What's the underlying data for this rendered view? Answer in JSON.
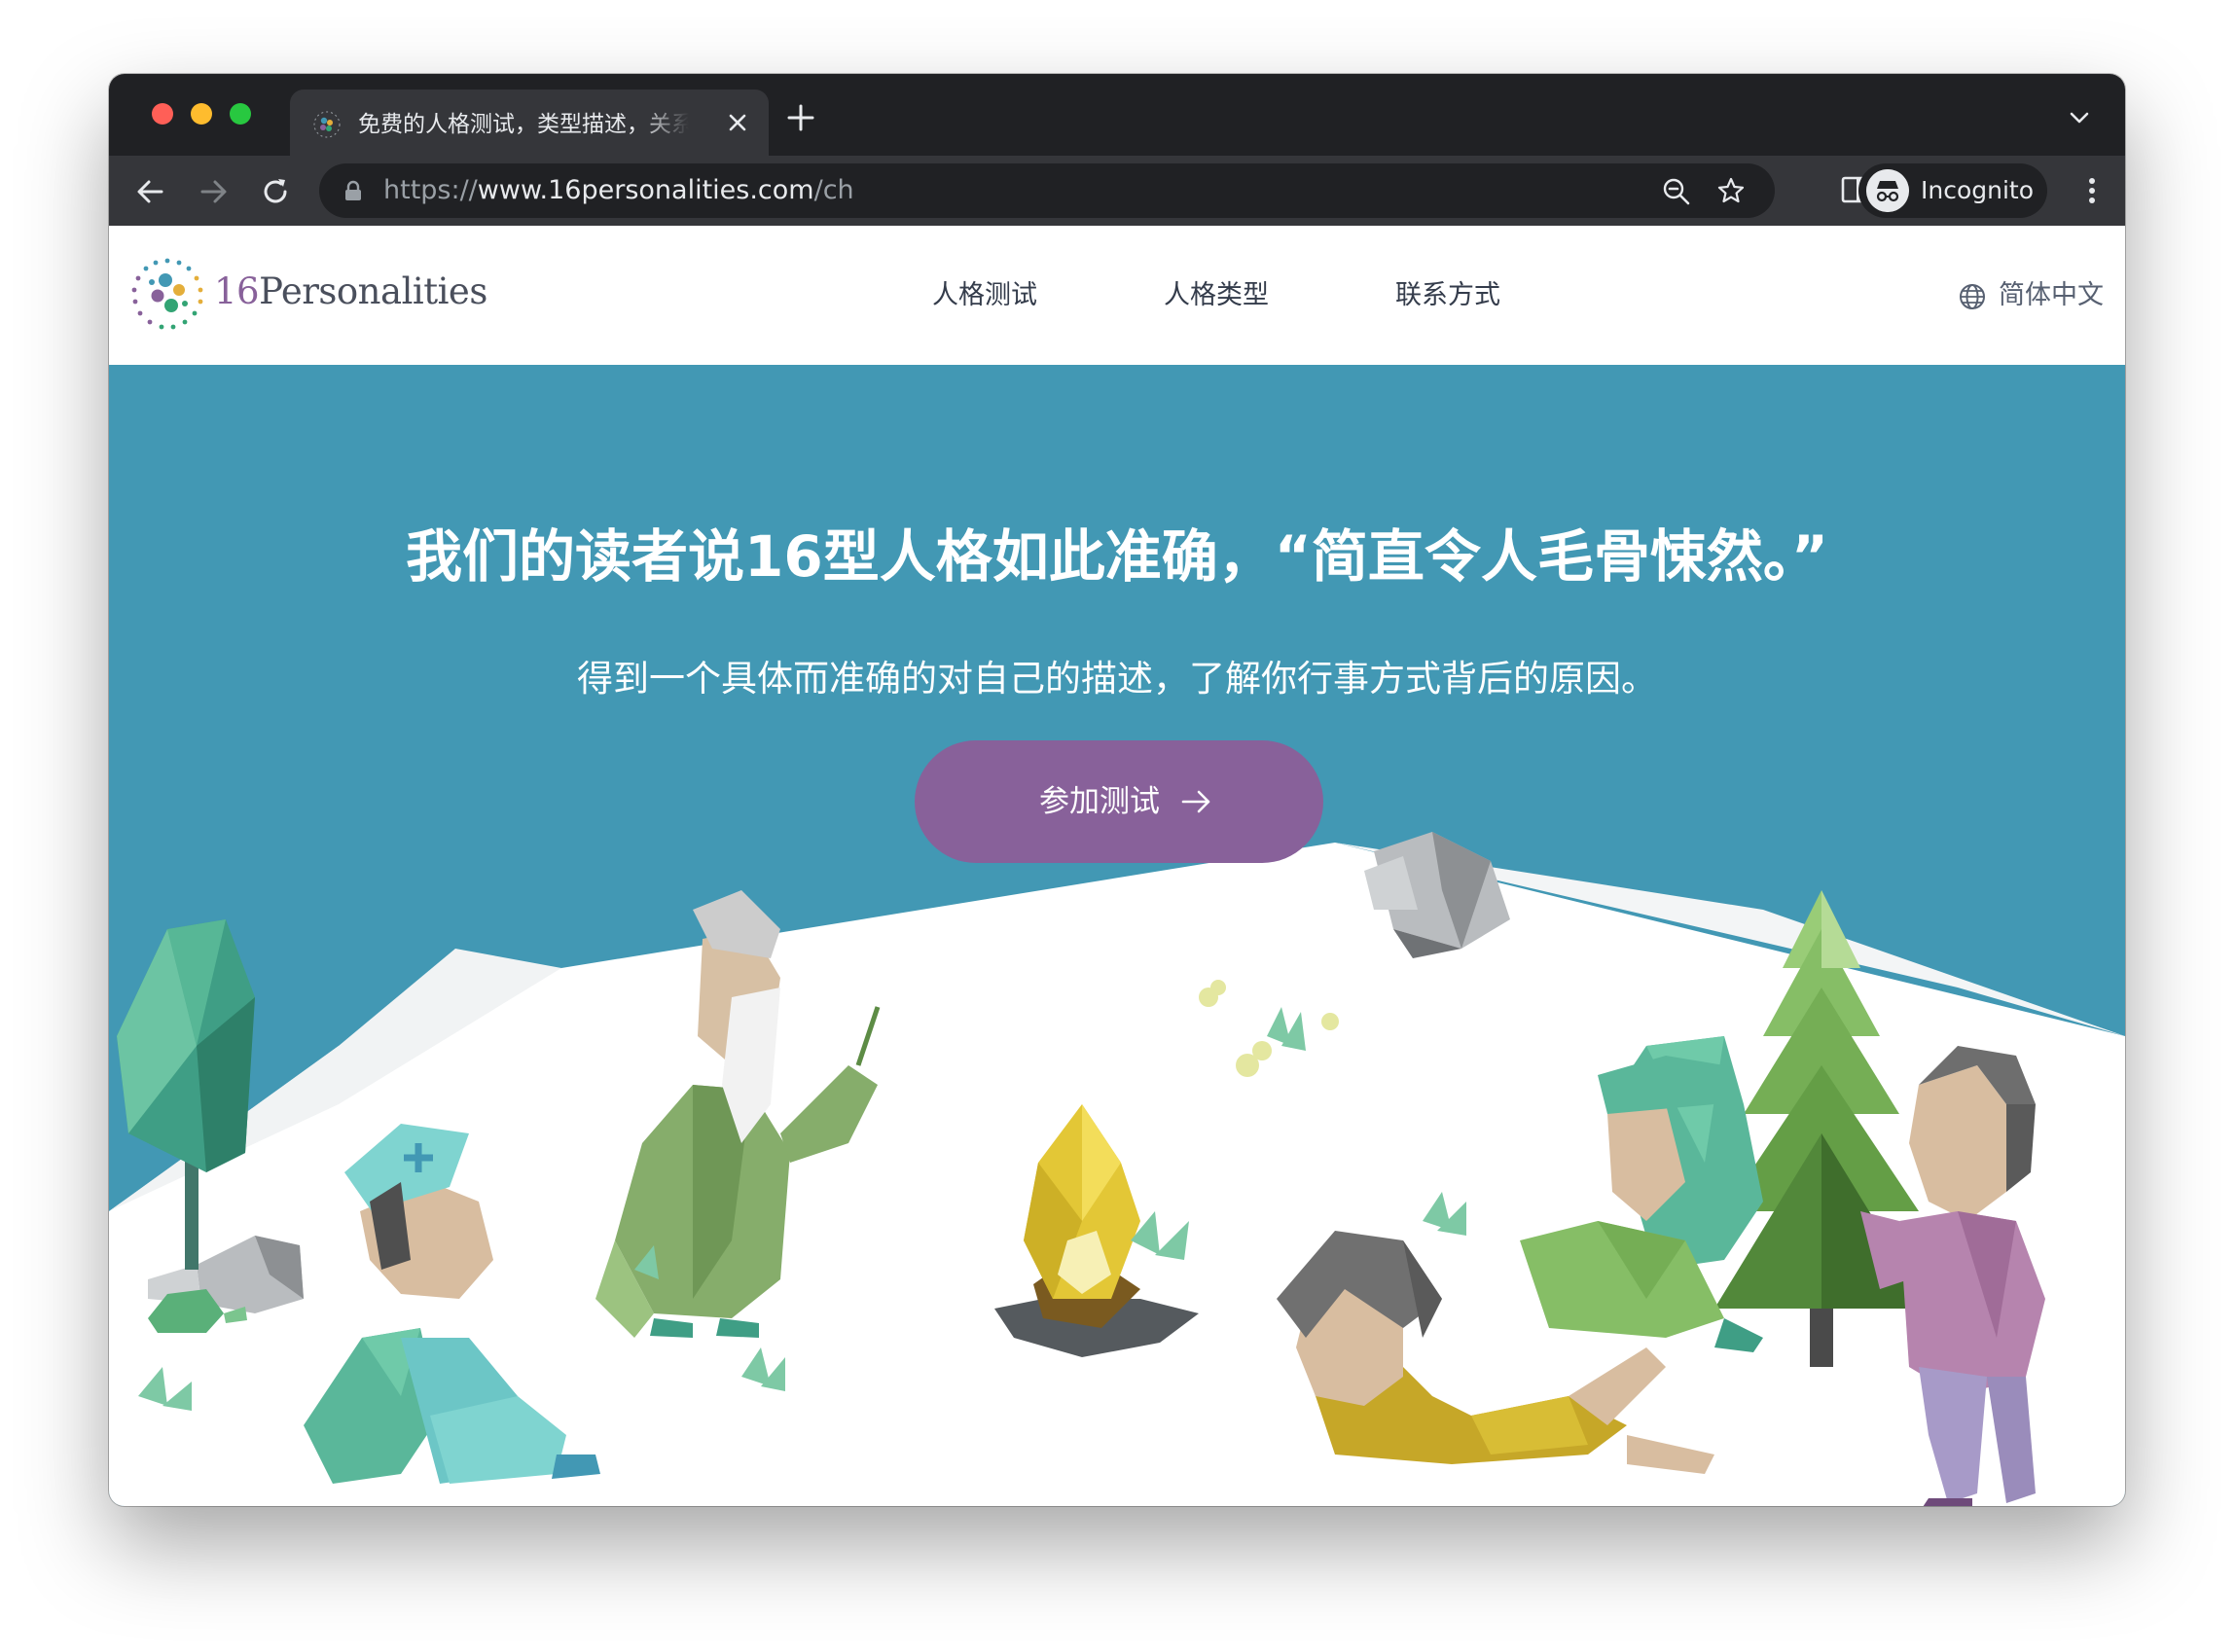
{
  "browser": {
    "tab_title": "免费的人格测试，类型描述，关系",
    "url_scheme": "https://",
    "url_host": "www.16personalities.com",
    "url_path": "/ch",
    "profile_label": "Incognito"
  },
  "site": {
    "logo_number": "16",
    "logo_word": "Personalities",
    "nav": [
      "人格测试",
      "人格类型",
      "联系方式"
    ],
    "language": "简体中文"
  },
  "hero": {
    "headline": "我们的读者说16型人格如此准确，“简直令人毛骨悚然。”",
    "subline": "得到一个具体而准确的对自己的描述，了解你行事方式背后的原因。",
    "cta_label": "参加测试"
  },
  "colors": {
    "hero_bg": "#4298b4",
    "cta_bg": "#88619a",
    "chrome_dark": "#202124",
    "chrome_toolbar": "#35363a"
  },
  "icons": [
    "favicon-icon",
    "close-icon",
    "plus-icon",
    "chevron-down-icon",
    "back-arrow-icon",
    "forward-arrow-icon",
    "reload-icon",
    "lock-icon",
    "zoom-icon",
    "star-icon",
    "side-panel-icon",
    "incognito-icon",
    "more-vert-icon",
    "globe-icon",
    "arrow-right-icon"
  ]
}
